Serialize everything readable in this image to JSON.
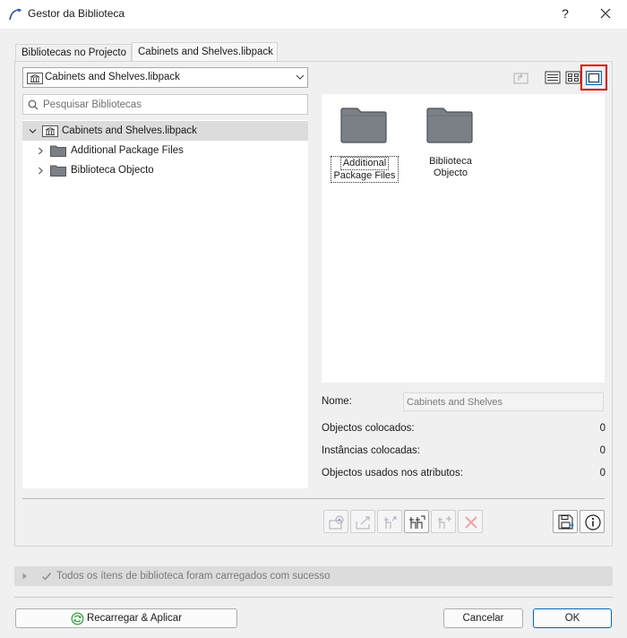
{
  "window": {
    "title": "Gestor da Biblioteca",
    "help_label": "?"
  },
  "tabs": [
    {
      "label": "Bibliotecas no Projecto",
      "active": false
    },
    {
      "label": "Cabinets and Shelves.libpack",
      "active": true
    }
  ],
  "library_select": {
    "value": "Cabinets and Shelves.libpack",
    "icon": "library-building-icon"
  },
  "view_toolbar": {
    "items": [
      "up-folder-icon",
      "list-view-icon",
      "small-icons-view-icon",
      "large-icons-view-icon"
    ],
    "selected": "large-icons-view-icon",
    "highlight_color": "#e00000"
  },
  "search": {
    "placeholder": "Pesquisar Bibliotecas",
    "value": ""
  },
  "tree": {
    "root": {
      "label": "Cabinets and Shelves.libpack",
      "expanded": true,
      "selected": true
    },
    "children": [
      {
        "label": "Additional Package Files",
        "expanded": false
      },
      {
        "label": "Biblioteca Objecto",
        "expanded": false
      }
    ]
  },
  "preview": {
    "items": [
      {
        "line1": "Additional",
        "line2": "Package Files",
        "focused": true
      },
      {
        "line1": "Biblioteca",
        "line2": "Objecto",
        "focused": false
      }
    ]
  },
  "details": {
    "name_label": "Nome:",
    "name_value": "Cabinets and Shelves",
    "placed_objects_label": "Objectos colocados:",
    "placed_objects_value": "0",
    "placed_instances_label": "Instâncias colocadas:",
    "placed_instances_value": "0",
    "attr_objects_label": "Objectos usados nos atributos:",
    "attr_objects_value": "0"
  },
  "action_buttons": [
    "add-library-icon",
    "export-icon",
    "move-object-icon",
    "copy-objects-icon",
    "add-object-icon",
    "delete-icon",
    "save-icon",
    "info-icon"
  ],
  "status": {
    "message": "Todos os ítens de biblioteca foram carregados com sucesso"
  },
  "footer": {
    "reload_label": "Recarregar & Aplicar",
    "cancel_label": "Cancelar",
    "ok_label": "OK"
  },
  "colors": {
    "accent": "#0067c0",
    "folder": "#7b7f86",
    "selection": "#dcdcdc",
    "reload_icon": "#2e9a3a"
  }
}
